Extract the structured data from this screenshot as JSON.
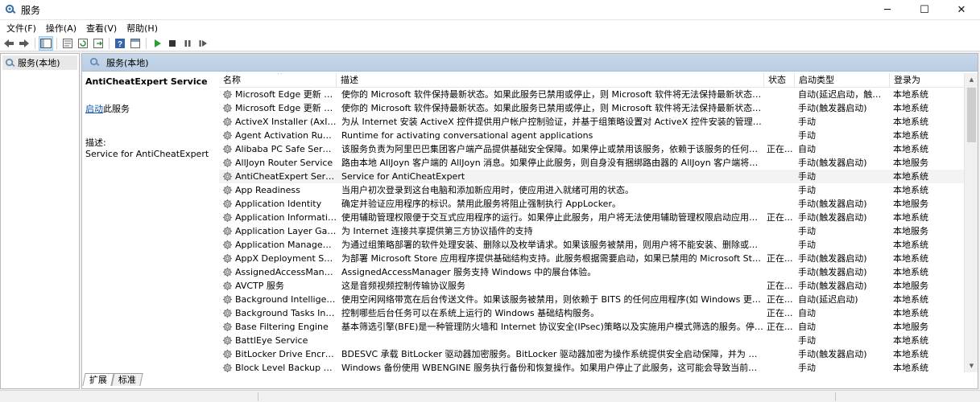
{
  "window": {
    "title": "服务",
    "minimize": "─",
    "maximize": "☐",
    "close": "✕"
  },
  "menu": [
    {
      "label": "文件(F)"
    },
    {
      "label": "操作(A)"
    },
    {
      "label": "查看(V)"
    },
    {
      "label": "帮助(H)"
    }
  ],
  "tree": {
    "item": "服务(本地)"
  },
  "pane": {
    "header": "服务(本地)"
  },
  "selected_service": {
    "title": "AntiCheatExpert Service",
    "link": "启动",
    "link_suffix": "此服务",
    "desc_label": "描述:",
    "desc_text": "Service for AntiCheatExpert"
  },
  "columns": {
    "name": "名称",
    "desc": "描述",
    "status": "状态",
    "start": "启动类型",
    "logon": "登录为"
  },
  "rows": [
    {
      "name": "Microsoft Edge 更新 服...",
      "desc": "使你的 Microsoft 软件保持最新状态。如果此服务已禁用或停止，则 Microsoft 软件将无法保持最新状态，这意味着无...",
      "status": "",
      "start": "自动(延迟启动，触发器...",
      "logon": "本地系统"
    },
    {
      "name": "Microsoft Edge 更新 服...",
      "desc": "使你的 Microsoft 软件保持最新状态。如果此服务已禁用或停止，则 Microsoft 软件将无法保持最新状态，这意味着无...",
      "status": "",
      "start": "手动(触发器启动)",
      "logon": "本地系统"
    },
    {
      "name": "ActiveX Installer (AxInstSV)",
      "desc": "为从 Internet 安装 ActiveX 控件提供用户帐户控制验证，并基于组策略设置对 ActiveX 控件安装的管理。此服务根...",
      "status": "",
      "start": "手动",
      "logon": "本地系统"
    },
    {
      "name": "Agent Activation Runtime...",
      "desc": "Runtime for activating conversational agent applications",
      "status": "",
      "start": "手动",
      "logon": "本地系统"
    },
    {
      "name": "Alibaba PC Safe Service",
      "desc": "该服务负责为阿里巴巴集团客户端产品提供基础安全保障。如果停止或禁用该服务，依赖于该服务的任何组件或应用程序...",
      "status": "正在...",
      "start": "自动",
      "logon": "本地系统"
    },
    {
      "name": "AllJoyn Router Service",
      "desc": "路由本地 AllJoyn 客户端的 AllJoyn 消息。如果停止此服务，则自身没有捆绑路由器的 AllJoyn 客户端将无法运行。",
      "status": "",
      "start": "手动(触发器启动)",
      "logon": "本地服务"
    },
    {
      "name": "AntiCheatExpert Service",
      "desc": "Service for AntiCheatExpert",
      "status": "",
      "start": "手动",
      "logon": "本地系统"
    },
    {
      "name": "App Readiness",
      "desc": "当用户初次登录到这台电脑和添加新应用时，使应用进入就绪可用的状态。",
      "status": "",
      "start": "手动",
      "logon": "本地系统"
    },
    {
      "name": "Application Identity",
      "desc": "确定并验证应用程序的标识。禁用此服务将阻止强制执行 AppLocker。",
      "status": "",
      "start": "手动(触发器启动)",
      "logon": "本地服务"
    },
    {
      "name": "Application Information",
      "desc": "使用辅助管理权限便于交互式应用程序的运行。如果停止此服务，用户将无法使用辅助管理权限启动应用程序，而执行所...",
      "status": "正在...",
      "start": "手动(触发器启动)",
      "logon": "本地系统"
    },
    {
      "name": "Application Layer Gatewa...",
      "desc": "为 Internet 连接共享提供第三方协议插件的支持",
      "status": "",
      "start": "手动",
      "logon": "本地服务"
    },
    {
      "name": "Application Management",
      "desc": "为通过组策略部署的软件处理安装、删除以及枚举请求。如果该服务被禁用，则用户将不能安装、删除或枚举通过组策略...",
      "status": "",
      "start": "手动",
      "logon": "本地系统"
    },
    {
      "name": "AppX Deployment Servic...",
      "desc": "为部署 Microsoft Store 应用程序提供基础结构支持。此服务根据需要启动，如果已禁用的 Microsoft Store 应用程序...",
      "status": "正在...",
      "start": "手动(触发器启动)",
      "logon": "本地系统"
    },
    {
      "name": "AssignedAccessManager...",
      "desc": "AssignedAccessManager 服务支持 Windows 中的展台体验。",
      "status": "",
      "start": "手动(触发器启动)",
      "logon": "本地系统"
    },
    {
      "name": "AVCTP 服务",
      "desc": "这是音频视频控制传输协议服务",
      "status": "正在...",
      "start": "手动(触发器启动)",
      "logon": "本地服务"
    },
    {
      "name": "Background Intelligent T...",
      "desc": "使用空闲网络带宽在后台传送文件。如果该服务被禁用，则依赖于 BITS 的任何应用程序(如 Windows 更新或 MSN Exp...",
      "status": "正在...",
      "start": "自动(延迟启动)",
      "logon": "本地系统"
    },
    {
      "name": "Background Tasks Infras...",
      "desc": "控制哪些后台任务可以在系统上运行的 Windows 基础结构服务。",
      "status": "正在...",
      "start": "自动",
      "logon": "本地系统"
    },
    {
      "name": "Base Filtering Engine",
      "desc": "基本筛选引擎(BFE)是一种管理防火墙和 Internet 协议安全(IPsec)策略以及实施用户模式筛选的服务。停止或禁用 BFE ...",
      "status": "正在...",
      "start": "自动",
      "logon": "本地服务"
    },
    {
      "name": "BattlEye Service",
      "desc": "",
      "status": "",
      "start": "手动",
      "logon": "本地系统"
    },
    {
      "name": "BitLocker Drive Encryptio...",
      "desc": "BDESVC 承载 BitLocker 驱动器加密服务。BitLocker 驱动器加密为操作系统提供安全启动保障，并为 OS、固定卷和可...",
      "status": "",
      "start": "手动(触发器启动)",
      "logon": "本地系统"
    },
    {
      "name": "Block Level Backup Engi...",
      "desc": "Windows 备份使用 WBENGINE 服务执行备份和恢复操作。如果用户停止了此服务，这可能会导致当前运行的备份或恢...",
      "status": "",
      "start": "手动",
      "logon": "本地系统"
    }
  ],
  "tabs": [
    {
      "label": "扩展"
    },
    {
      "label": "标准"
    }
  ]
}
